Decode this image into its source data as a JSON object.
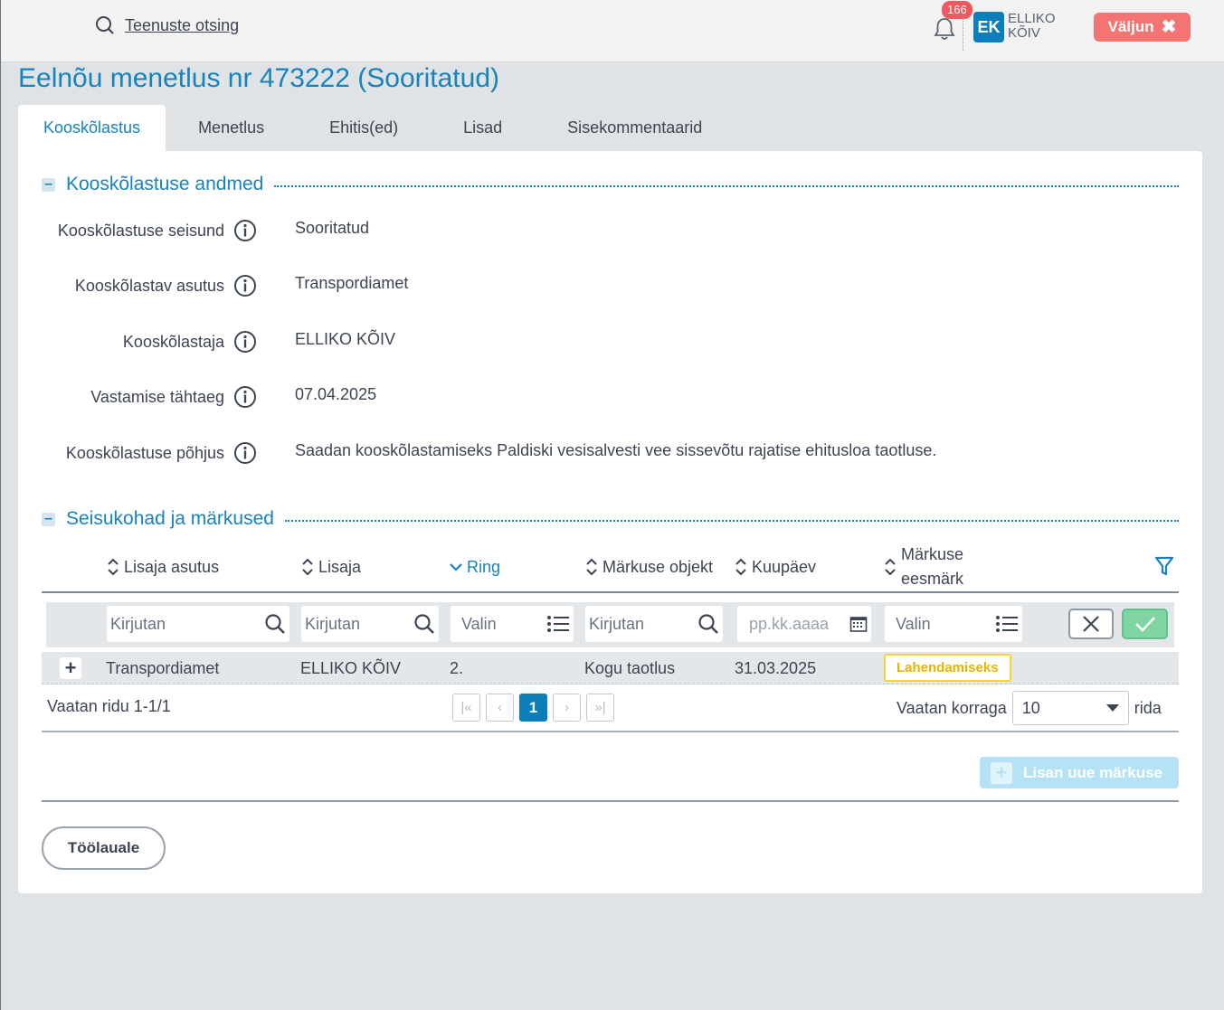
{
  "header": {
    "search_label": "Teenuste otsing",
    "notifications_count": "166",
    "avatar_initials": "EK",
    "user_first": "ELLIKO",
    "user_last": "KÕIV",
    "logout_label": "Väljun"
  },
  "page_title": "Eelnõu menetlus nr 473222 (Sooritatud)",
  "tabs": [
    {
      "label": "Kooskõlastus",
      "active": true
    },
    {
      "label": "Menetlus"
    },
    {
      "label": "Ehitis(ed)"
    },
    {
      "label": "Lisad"
    },
    {
      "label": "Sisekommentaarid"
    }
  ],
  "section1": {
    "title": "Kooskõlastuse andmed",
    "fields": [
      {
        "label": "Kooskõlastuse seisund",
        "value": "Sooritatud"
      },
      {
        "label": "Kooskõlastav asutus",
        "value": "Transpordiamet"
      },
      {
        "label": "Kooskõlastaja",
        "value": "ELLIKO KÕIV"
      },
      {
        "label": "Vastamise tähtaeg",
        "value": "07.04.2025"
      },
      {
        "label": "Kooskõlastuse põhjus",
        "value": "Saadan kooskõlastamiseks Paldiski vesisalvesti vee sissevõtu rajatise ehitusloa taotluse."
      }
    ]
  },
  "section2": {
    "title": "Seisukohad ja märkused",
    "columns": [
      "Lisaja asutus",
      "Lisaja",
      "Ring",
      "Märkuse objekt",
      "Kuupäev",
      "Märkuse",
      "eesmärk"
    ],
    "filters": {
      "f1": "Kirjutan",
      "f2": "Kirjutan",
      "f3": "Valin",
      "f4": "Kirjutan",
      "f5": "pp.kk.aaaa",
      "f6": "Valin"
    },
    "row": {
      "asutus": "Transpordiamet",
      "lisaja": "ELLIKO KÕIV",
      "ring": "2.",
      "objekt": "Kogu taotlus",
      "kuupaev": "31.03.2025",
      "eesmark": "Lahendamiseks"
    },
    "pagination": {
      "info": "Vaatan ridu 1-1/1",
      "current_page": "1",
      "per_page_label": "Vaatan korraga",
      "per_page_value": "10",
      "per_page_suffix": "rida"
    },
    "add_label": "Lisan uue märkuse"
  },
  "desk_button": "Töölauale",
  "colors": {
    "accent": "#1783bd",
    "logout": "#f47373",
    "tag_border": "#f5d536",
    "confirm": "#7fd6a2"
  }
}
